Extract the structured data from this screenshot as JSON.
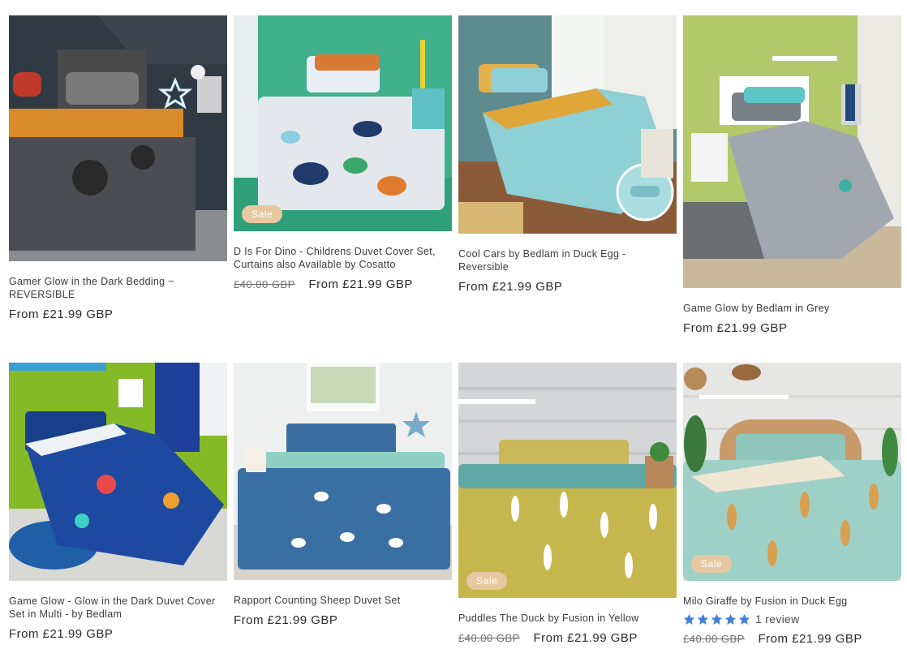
{
  "colors": {
    "sale_badge": "#e8c8a0",
    "star": "#3f7fd8",
    "price": "#2b2b2b"
  },
  "sale_badge_label": "Sale",
  "products": [
    {
      "title": "Gamer Glow in the Dark Bedding ~ REVERSIBLE",
      "price": "From £21.99 GBP",
      "compare_price": null,
      "on_sale": false,
      "image": "grey gamer duvet with neon star"
    },
    {
      "title": "D Is For Dino - Childrens Duvet Cover Set, Curtains also Available by Cosatto",
      "price": "From £21.99 GBP",
      "compare_price": "£40.00 GBP",
      "on_sale": true,
      "image": "white duvet with colourful dinosaurs"
    },
    {
      "title": "Cool Cars by Bedlam in Duck Egg - Reversible",
      "price": "From £21.99 GBP",
      "compare_price": null,
      "on_sale": false,
      "image": "duck egg duvet with cars"
    },
    {
      "title": "Game Glow by Bedlam in Grey",
      "price": "From £21.99 GBP",
      "compare_price": null,
      "on_sale": false,
      "image": "grey game over duvet"
    },
    {
      "title": "Game Glow - Glow in the Dark Duvet Cover Set in Multi - by Bedlam",
      "price": "From £21.99 GBP",
      "compare_price": null,
      "on_sale": false,
      "image": "blue multi game duvet"
    },
    {
      "title": "Rapport Counting Sheep Duvet Set",
      "price": "From £21.99 GBP",
      "compare_price": null,
      "on_sale": false,
      "image": "blue duvet with sheep"
    },
    {
      "title": "Puddles The Duck by Fusion in Yellow",
      "price": "From £21.99 GBP",
      "compare_price": "£40.00 GBP",
      "on_sale": true,
      "image": "yellow duvet with ducks"
    },
    {
      "title": "Milo Giraffe by Fusion in Duck Egg",
      "price": "From £21.99 GBP",
      "compare_price": "£40.00 GBP",
      "on_sale": true,
      "image": "duck egg duvet with giraffes",
      "rating": {
        "stars": 5,
        "review_text": "1 review"
      }
    }
  ]
}
